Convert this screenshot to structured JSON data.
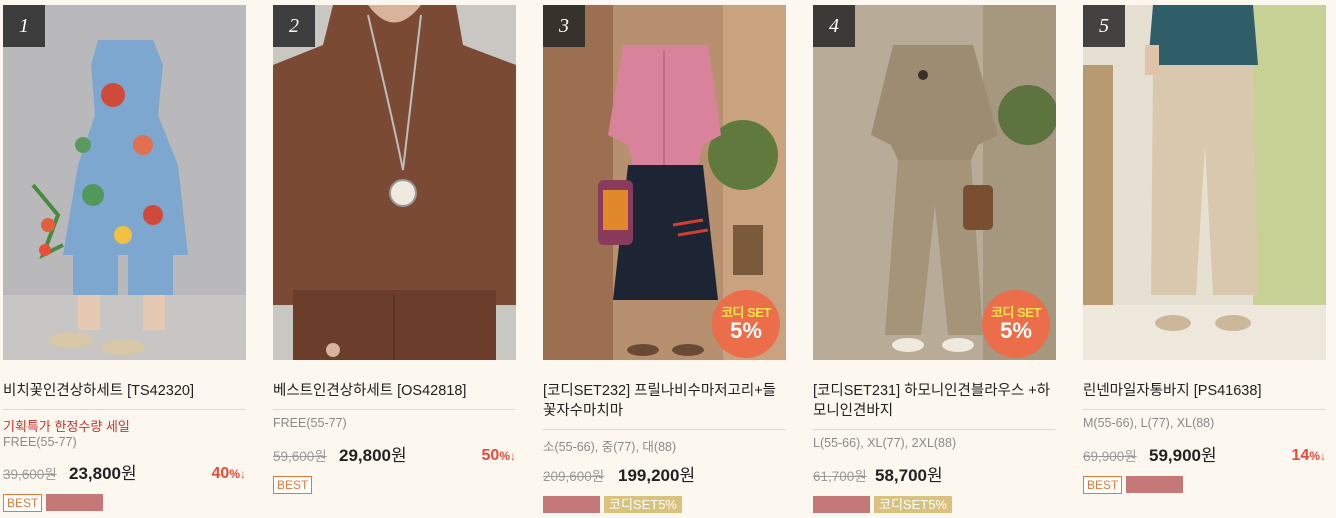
{
  "products": [
    {
      "rank": "1",
      "name": "비치꽃인견상하세트 [TS42320]",
      "promo": "기획특가 한정수량 세일",
      "sizes": "FREE(55-77)",
      "price_original": "39,600원",
      "price_sale": "23,800",
      "currency": "원",
      "discount": "40",
      "discount_unit": "%↓",
      "tag_best": "BEST",
      "set_badge": null
    },
    {
      "rank": "2",
      "name": "베스트인견상하세트 [OS42818]",
      "sizes": "FREE(55-77)",
      "price_original": "59,600원",
      "price_sale": "29,800",
      "currency": "원",
      "discount": "50",
      "discount_unit": "%↓",
      "tag_best": "BEST"
    },
    {
      "rank": "3",
      "name": "[코디SET232] 프릴나비수마저고리+들꽃자수마치마",
      "sizes": "소(55-66), 중(77), 대(88)",
      "price_original": "209,600원",
      "price_sale": "199,200",
      "currency": "원",
      "tag_set": "코디SET5%",
      "set_badge_line1": "코디 SET",
      "set_badge_line2": "5%"
    },
    {
      "rank": "4",
      "name": "[코디SET231] 하모니인견블라우스 +하모니인견바지",
      "sizes": "L(55-66), XL(77), 2XL(88)",
      "price_original": "61,700원",
      "price_sale": "58,700",
      "currency": "원",
      "tag_set": "코디SET5%",
      "set_badge_line1": "코디 SET",
      "set_badge_line2": "5%"
    },
    {
      "rank": "5",
      "name": "린넨마일자통바지 [PS41638]",
      "sizes": "M(55-66), L(77), XL(88)",
      "price_original": "69,900원",
      "price_sale": "59,900",
      "currency": "원",
      "discount": "14",
      "discount_unit": "%↓",
      "tag_best": "BEST"
    }
  ],
  "colors": {
    "background": "#fdf8ef",
    "promo_red": "#d82b2b",
    "discount_red": "#e84a3a",
    "best_orange": "#e07a3a",
    "rose_tag": "#c47878",
    "set_tag": "#d9c27d",
    "set_badge": "#ec6d4a"
  }
}
